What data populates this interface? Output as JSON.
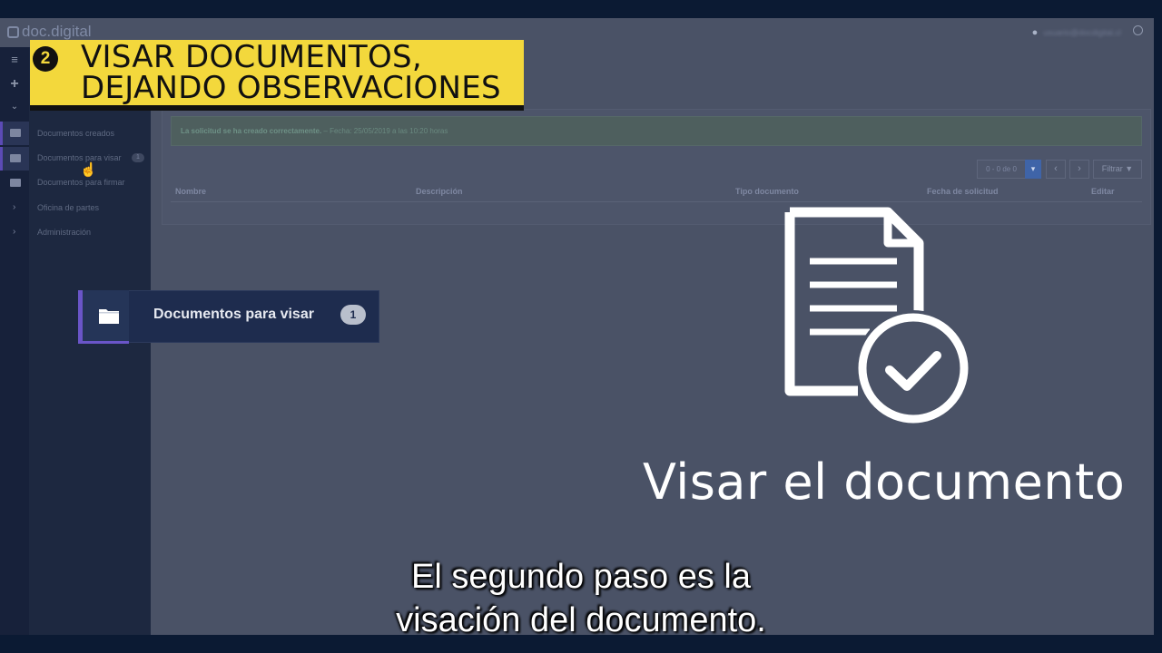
{
  "app": {
    "name": "doc.digital",
    "user_name": "usuario@docdigital.cl"
  },
  "step": {
    "number": "2",
    "title": "VISAR DOCUMENTOS,\nDEJANDO OBSERVACIONES"
  },
  "sidebar": {
    "items": [
      {
        "label": "Documentos creados"
      },
      {
        "label": "Documentos para visar",
        "badge": "1"
      },
      {
        "label": "Documentos para firmar"
      },
      {
        "label": "Oficina de partes"
      },
      {
        "label": "Administración"
      }
    ]
  },
  "alert": {
    "message": "La solicitud se ha creado correctamente.",
    "detail": " – Fecha: 25/05/2019 a las 10:20 horas"
  },
  "pagination": {
    "range": "0 - 0 de 0",
    "filter_label": "Filtrar"
  },
  "table": {
    "headers": [
      "Nombre",
      "Descripción",
      "Tipo documento",
      "Fecha de solicitud",
      "Editar"
    ]
  },
  "callout": {
    "label": "Documentos para visar",
    "badge": "1"
  },
  "caption": "Visar el documento",
  "subtitle": "El segundo paso es la\nvisación del documento.",
  "colors": {
    "step_bg": "#f3d83c",
    "accent": "#6a55c8",
    "content_bg": "#4a5266",
    "sidebar_bg": "#1d2840"
  }
}
